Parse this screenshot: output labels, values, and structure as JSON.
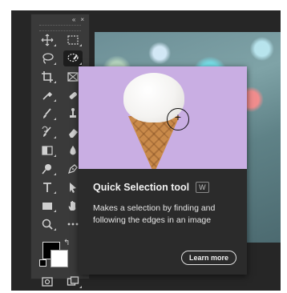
{
  "toolbar": {
    "collapse_icon": "double-chevron-left-icon",
    "close_icon": "close-icon",
    "collapse_glyph": "«",
    "close_glyph": "×",
    "tools": [
      [
        "move-tool-icon",
        "rectangular-marquee-icon"
      ],
      [
        "lasso-icon",
        "quick-selection-icon"
      ],
      [
        "crop-icon",
        "frame-icon"
      ],
      [
        "eyedropper-icon",
        "healing-brush-icon"
      ],
      [
        "brush-icon",
        "clone-stamp-icon"
      ],
      [
        "history-brush-icon",
        "eraser-icon"
      ],
      [
        "gradient-icon",
        "blur-drop-icon"
      ],
      [
        "dodge-icon",
        "pen-icon"
      ],
      [
        "type-icon",
        "path-selection-icon"
      ],
      [
        "rectangle-icon",
        "hand-icon"
      ],
      [
        "zoom-icon",
        "more-tools-icon"
      ]
    ],
    "active_tool": "quick-selection-icon",
    "colors": {
      "foreground": "#000000",
      "background": "#ffffff"
    },
    "swap_glyph": "↰"
  },
  "tooltip": {
    "title": "Quick Selection tool",
    "shortcut": "W",
    "description": "Makes a selection by finding and following the edges in an image",
    "button": "Learn more",
    "cursor_glyph": "+"
  }
}
